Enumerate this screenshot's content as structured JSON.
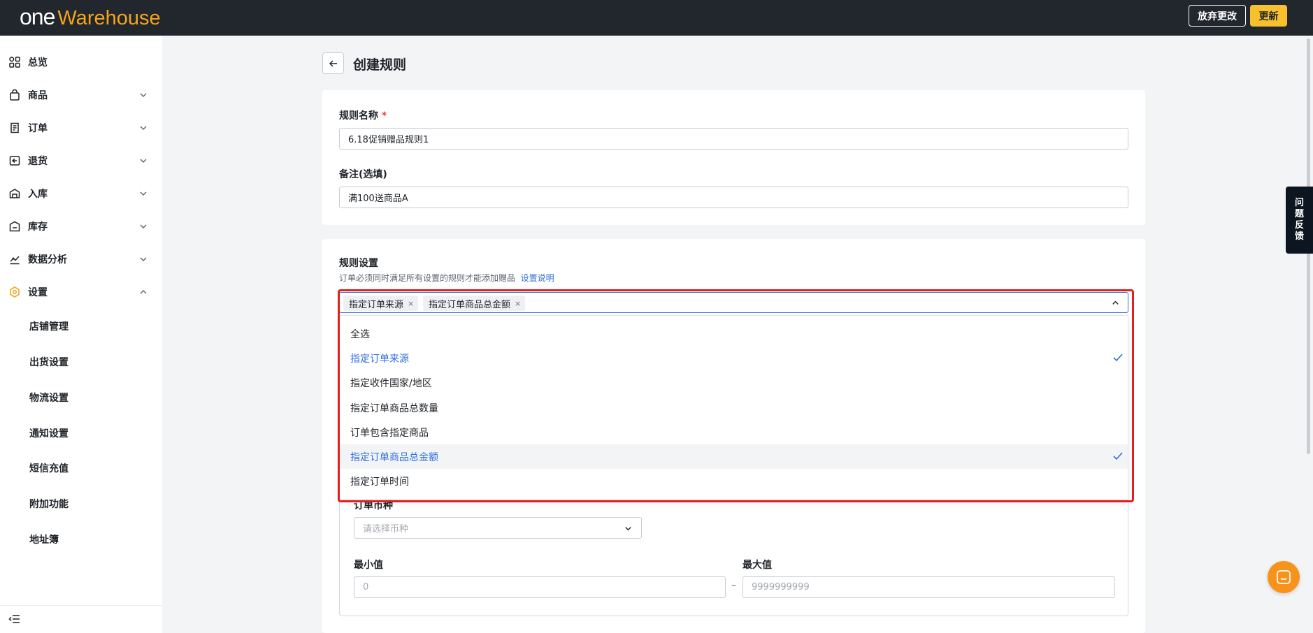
{
  "app": {
    "logo_one": "one",
    "logo_warehouse": "Warehouse",
    "discard_label": "放弃更改",
    "update_label": "更新",
    "brand_color": "#f4a51c",
    "accent_color": "#2f6fe0"
  },
  "sidebar": {
    "items": [
      {
        "label": "总览",
        "icon": "dashboard-icon"
      },
      {
        "label": "商品",
        "icon": "product-bag-icon"
      },
      {
        "label": "订单",
        "icon": "order-icon"
      },
      {
        "label": "退货",
        "icon": "return-icon"
      },
      {
        "label": "入库",
        "icon": "inbound-icon"
      },
      {
        "label": "库存",
        "icon": "inventory-icon"
      },
      {
        "label": "数据分析",
        "icon": "analytics-icon"
      },
      {
        "label": "设置",
        "icon": "settings-hex-icon"
      }
    ],
    "settings_sub": [
      "店铺管理",
      "出货设置",
      "物流设置",
      "通知设置",
      "短信充值",
      "附加功能",
      "地址簿"
    ]
  },
  "page": {
    "title": "创建规则"
  },
  "basic": {
    "name_label": "规则名称",
    "required_mark": "*",
    "name_value": "6.18促销赠品规则1",
    "note_label": "备注(选填)",
    "note_value": "满100送商品A"
  },
  "rules": {
    "heading": "规则设置",
    "hint": "订单必须同时满足所有设置的规则才能添加赠品",
    "hint_link": "设置说明",
    "tags": [
      "指定订单来源",
      "指定订单商品总金额"
    ],
    "tag_remove": "×",
    "options": [
      {
        "label": "全选",
        "selected": false
      },
      {
        "label": "指定订单来源",
        "selected": true
      },
      {
        "label": "指定收件国家/地区",
        "selected": false
      },
      {
        "label": "指定订单商品总数量",
        "selected": false
      },
      {
        "label": "订单包含指定商品",
        "selected": false
      },
      {
        "label": "指定订单商品总金额",
        "selected": true
      },
      {
        "label": "指定订单时间",
        "selected": false
      }
    ]
  },
  "amount": {
    "currency_label": "订单币种",
    "currency_placeholder": "请选择币种",
    "min_label": "最小值",
    "min_placeholder": "0",
    "max_label": "最大值",
    "max_placeholder": "9999999999",
    "range_separator": "–"
  },
  "feedback": {
    "chars": [
      "问",
      "题",
      "反",
      "馈"
    ]
  }
}
